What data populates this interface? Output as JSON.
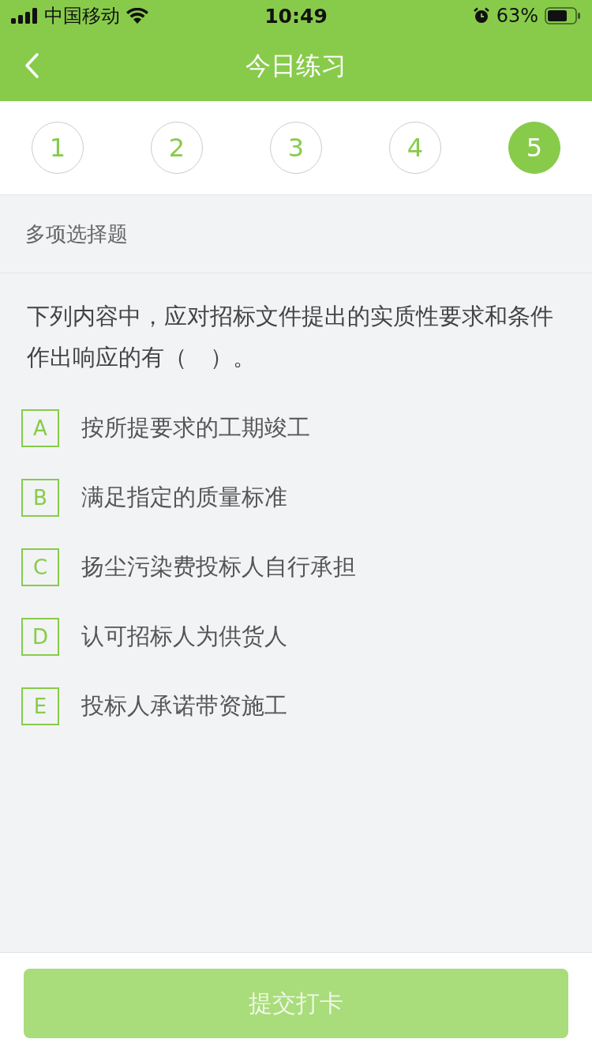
{
  "status_bar": {
    "carrier": "中国移动",
    "time": "10:49",
    "battery": "63%"
  },
  "nav": {
    "title": "今日练习"
  },
  "steps": [
    {
      "label": "1",
      "selected": false
    },
    {
      "label": "2",
      "selected": false
    },
    {
      "label": "3",
      "selected": false
    },
    {
      "label": "4",
      "selected": false
    },
    {
      "label": "5",
      "selected": true
    }
  ],
  "question": {
    "type_label": "多项选择题",
    "text": "下列内容中，应对招标文件提出的实质性要求和条件作出响应的有（　）。",
    "options": [
      {
        "letter": "A",
        "text": "按所提要求的工期竣工",
        "selected": false
      },
      {
        "letter": "B",
        "text": "满足指定的质量标准",
        "selected": false
      },
      {
        "letter": "C",
        "text": "扬尘污染费投标人自行承担",
        "selected": false
      },
      {
        "letter": "D",
        "text": "认可招标人为供货人",
        "selected": false
      },
      {
        "letter": "E",
        "text": "投标人承诺带资施工",
        "selected": false
      }
    ]
  },
  "submit": {
    "label": "提交打卡",
    "disabled": true
  }
}
